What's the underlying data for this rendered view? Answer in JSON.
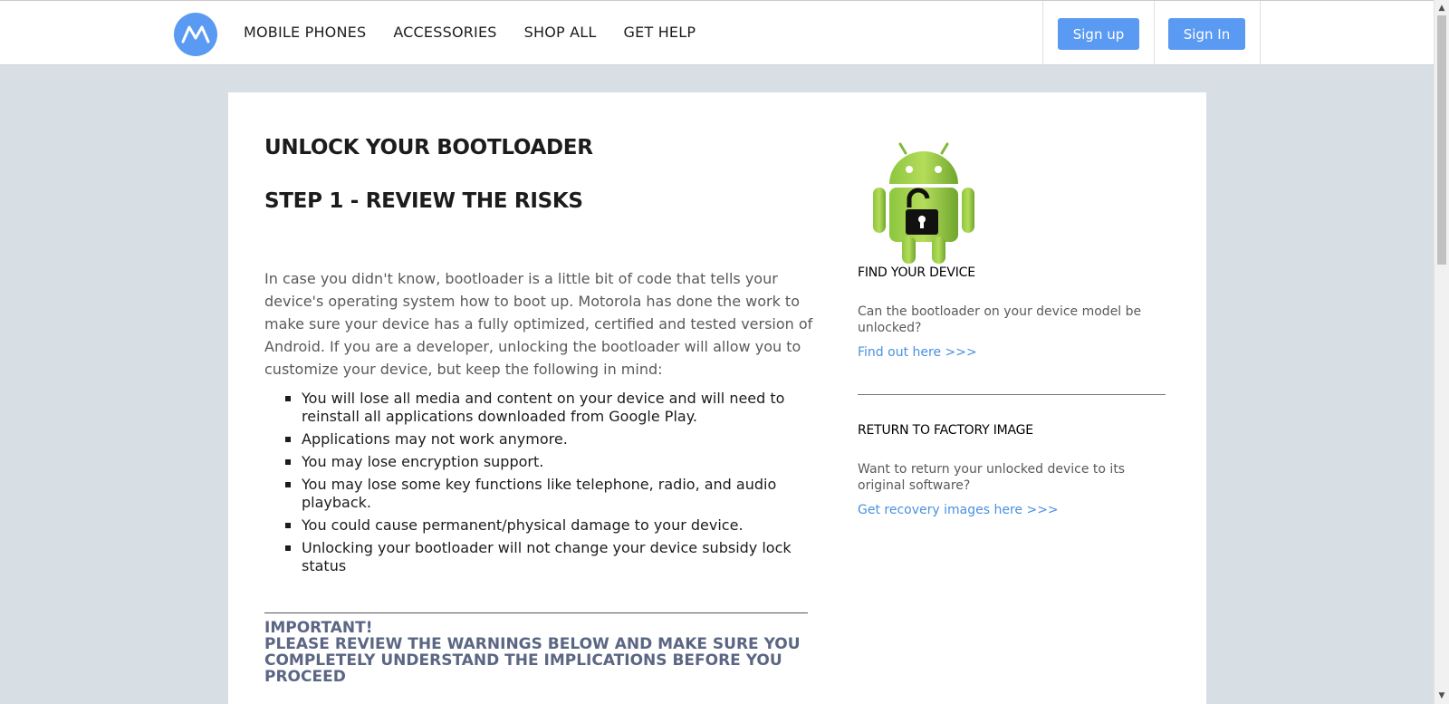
{
  "header": {
    "logo_icon": "motorola-logo-icon",
    "nav": [
      {
        "label": "MOBILE PHONES"
      },
      {
        "label": "ACCESSORIES"
      },
      {
        "label": "SHOP ALL"
      },
      {
        "label": "GET HELP"
      }
    ],
    "signup_label": "Sign up",
    "signin_label": "Sign In"
  },
  "main": {
    "title": "UNLOCK YOUR BOOTLOADER",
    "step_title": "STEP 1 - REVIEW THE RISKS",
    "intro": "In case you didn't know, bootloader is a little bit of code that tells your device's operating system how to boot up. Motorola has done the work to make sure your device has a fully optimized, certified and tested version of Android. If you are a developer, unlocking the bootloader will allow you to customize your device, but keep the following in mind:",
    "risks": [
      "You will lose all media and content on your device and will need to reinstall all applications downloaded from Google Play.",
      "Applications may not work anymore.",
      "You may lose encryption support.",
      "You may lose some key functions like telephone, radio, and audio playback.",
      "You could cause permanent/physical damage to your device.",
      "Unlocking your bootloader will not change your device subsidy lock status"
    ],
    "important_heading": "IMPORTANT!",
    "important_text": "PLEASE REVIEW THE WARNINGS BELOW AND MAKE SURE YOU COMPLETELY UNDERSTAND THE IMPLICATIONS BEFORE YOU PROCEED"
  },
  "sidebar": {
    "image_icon": "android-unlocked-icon",
    "find_title": "FIND YOUR DEVICE",
    "find_text": "Can the bootloader on your device model be unlocked?",
    "find_link": "Find out here >>>",
    "factory_title": "RETURN TO FACTORY IMAGE",
    "factory_text": "Want to return your unlocked device to its original software?",
    "factory_link": "Get recovery images here >>>"
  },
  "colors": {
    "accent": "#5a9af2",
    "link": "#4a90e2",
    "background": "#d7dee4",
    "important": "#5b6684"
  }
}
